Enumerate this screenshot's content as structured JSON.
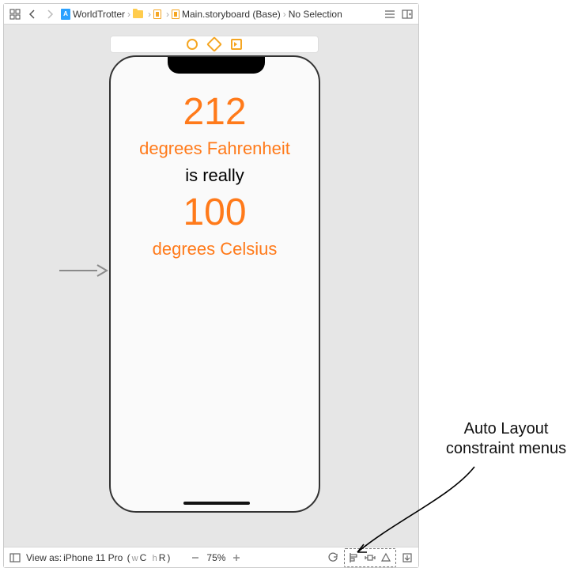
{
  "breadcrumb": {
    "items": [
      {
        "label": "WorldTrotter"
      },
      {
        "label": ""
      },
      {
        "label": ""
      },
      {
        "label": "Main.storyboard (Base)"
      },
      {
        "label": "No Selection"
      }
    ]
  },
  "scene": {
    "labels": {
      "f_value": "212",
      "f_unit": "degrees Fahrenheit",
      "middle": "is really",
      "c_value": "100",
      "c_unit": "degrees Celsius"
    }
  },
  "bottom": {
    "view_as_prefix": "View as: ",
    "device": "iPhone 11 Pro",
    "size_w_prefix": "w",
    "size_w": "C",
    "size_h_prefix": "h",
    "size_h": "R",
    "zoom": "75%"
  },
  "annotation": {
    "line1": "Auto Layout",
    "line2": "constraint menus"
  }
}
